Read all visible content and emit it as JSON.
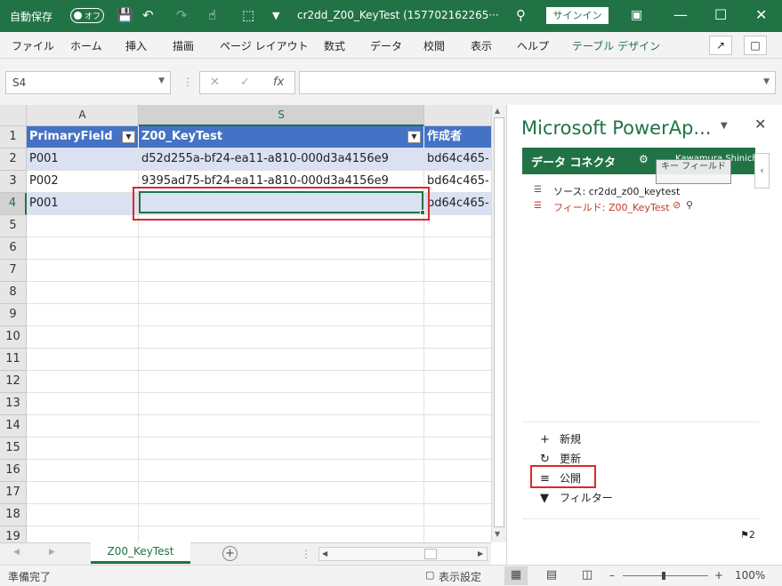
{
  "titlebar": {
    "autosave_label": "自動保存",
    "autosave_state": "オフ",
    "doc_title": "cr2dd_Z00_KeyTest (157702162265···",
    "signin_label": "サインイン"
  },
  "ribbon": {
    "tabs": [
      {
        "label": "ファイル"
      },
      {
        "label": "ホーム"
      },
      {
        "label": "挿入"
      },
      {
        "label": "描画"
      },
      {
        "label": "ページ レイアウト"
      },
      {
        "label": "数式"
      },
      {
        "label": "データ"
      },
      {
        "label": "校閲"
      },
      {
        "label": "表示"
      },
      {
        "label": "ヘルプ"
      },
      {
        "label": "テーブル デザイン"
      }
    ]
  },
  "formula_bar": {
    "name_box": "S4",
    "fx_label": "fx",
    "value": ""
  },
  "grid": {
    "columns": [
      "A",
      "S",
      ""
    ],
    "selected_column": "S",
    "headers": [
      "PrimaryField",
      "Z00_KeyTest",
      "作成者"
    ],
    "rows": [
      {
        "n": "1"
      },
      {
        "n": "2",
        "cells": [
          "P001",
          "d52d255a-bf24-ea11-a810-000d3a4156e9",
          "bd64c465-"
        ]
      },
      {
        "n": "3",
        "cells": [
          "P002",
          "9395ad75-bf24-ea11-a810-000d3a4156e9",
          "bd64c465-"
        ]
      },
      {
        "n": "4",
        "cells": [
          "P001",
          "",
          "bd64c465-"
        ]
      },
      {
        "n": "5"
      },
      {
        "n": "6"
      },
      {
        "n": "7"
      },
      {
        "n": "8"
      },
      {
        "n": "9"
      },
      {
        "n": "10"
      },
      {
        "n": "11"
      },
      {
        "n": "12"
      },
      {
        "n": "13"
      },
      {
        "n": "14"
      },
      {
        "n": "15"
      },
      {
        "n": "16"
      },
      {
        "n": "17"
      },
      {
        "n": "18"
      },
      {
        "n": "19"
      }
    ],
    "selected_cell": "S4"
  },
  "sheet_tabs": {
    "active": "Z00_KeyTest"
  },
  "panel": {
    "title": "Microsoft PowerAp...",
    "bar_label": "データ コネクタ",
    "user": "Kawamura Shinichi",
    "tooltip": "キー フィールド",
    "source_line": "ソース: cr2dd_z00_keytest",
    "field_line": "フィールド: Z00_KeyTest",
    "actions": {
      "new": "新規",
      "refresh": "更新",
      "publish": "公開",
      "filter": "フィルター"
    },
    "count": "2"
  },
  "statusbar": {
    "ready": "準備完了",
    "display_settings": "表示設定",
    "zoom": "100%"
  },
  "colors": {
    "excel_green": "#217346",
    "table_header": "#4472c4",
    "table_band": "#d9e1f2",
    "highlight_red": "#e0262b"
  }
}
